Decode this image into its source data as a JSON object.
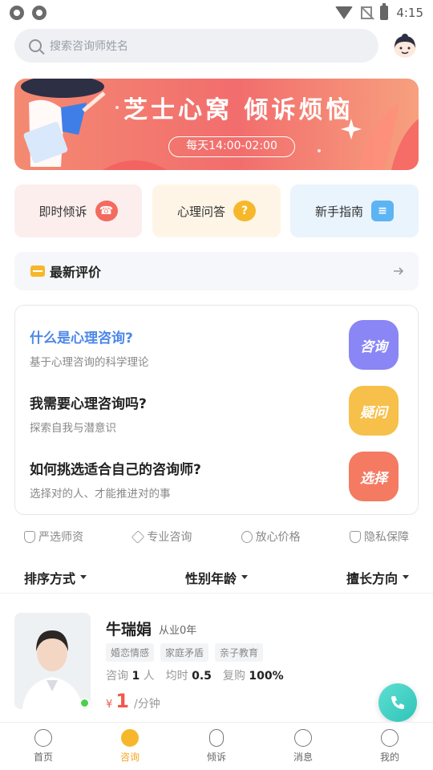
{
  "status_bar": {
    "time": "4:15"
  },
  "search": {
    "placeholder": "搜索咨询师姓名"
  },
  "banner": {
    "title": "芝士心窝 倾诉烦恼",
    "time_text": "每天14:00-02:00"
  },
  "quick_entries": [
    {
      "label": "即时倾诉",
      "icon": "phone-chat-icon",
      "color": "#f36b5f"
    },
    {
      "label": "心理问答",
      "icon": "question-bubble-icon",
      "color": "#f6b82a"
    },
    {
      "label": "新手指南",
      "icon": "guide-doc-icon",
      "color": "#5db4f2"
    }
  ],
  "latest_review": {
    "label": "最新评价"
  },
  "faq": [
    {
      "title": "什么是心理咨询?",
      "subtitle": "基于心理咨询的科学理论",
      "badge": "咨询",
      "badge_color": "#8a86f5"
    },
    {
      "title": "我需要心理咨询吗?",
      "subtitle": "探索自我与潜意识",
      "badge": "疑问",
      "badge_color": "#f6c04a"
    },
    {
      "title": "如何挑选适合自己的咨询师?",
      "subtitle": "选择对的人、才能推进对的事",
      "badge": "选择",
      "badge_color": "#f47a62"
    }
  ],
  "guarantees": [
    "严选师资",
    "专业咨询",
    "放心价格",
    "隐私保障"
  ],
  "filters": [
    "排序方式",
    "性别年龄",
    "擅长方向"
  ],
  "counselor": {
    "name": "牛瑞娟",
    "experience": "从业0年",
    "tags": [
      "婚恋情感",
      "家庭矛盾",
      "亲子教育"
    ],
    "stats": {
      "consult_label": "咨询",
      "consult_count": "1",
      "consult_unit": "人",
      "avg_label": "均时",
      "avg_value": "0.5",
      "repurchase_label": "复购",
      "repurchase_value": "100%"
    },
    "price": {
      "currency": "¥",
      "value": "1",
      "unit": "/分钟"
    }
  },
  "bottom_nav": [
    {
      "label": "首页",
      "icon": "home-icon",
      "active": false
    },
    {
      "label": "咨询",
      "icon": "consult-icon",
      "active": true
    },
    {
      "label": "倾诉",
      "icon": "microphone-icon",
      "active": false
    },
    {
      "label": "消息",
      "icon": "message-icon",
      "active": false
    },
    {
      "label": "我的",
      "icon": "profile-icon",
      "active": false
    }
  ]
}
